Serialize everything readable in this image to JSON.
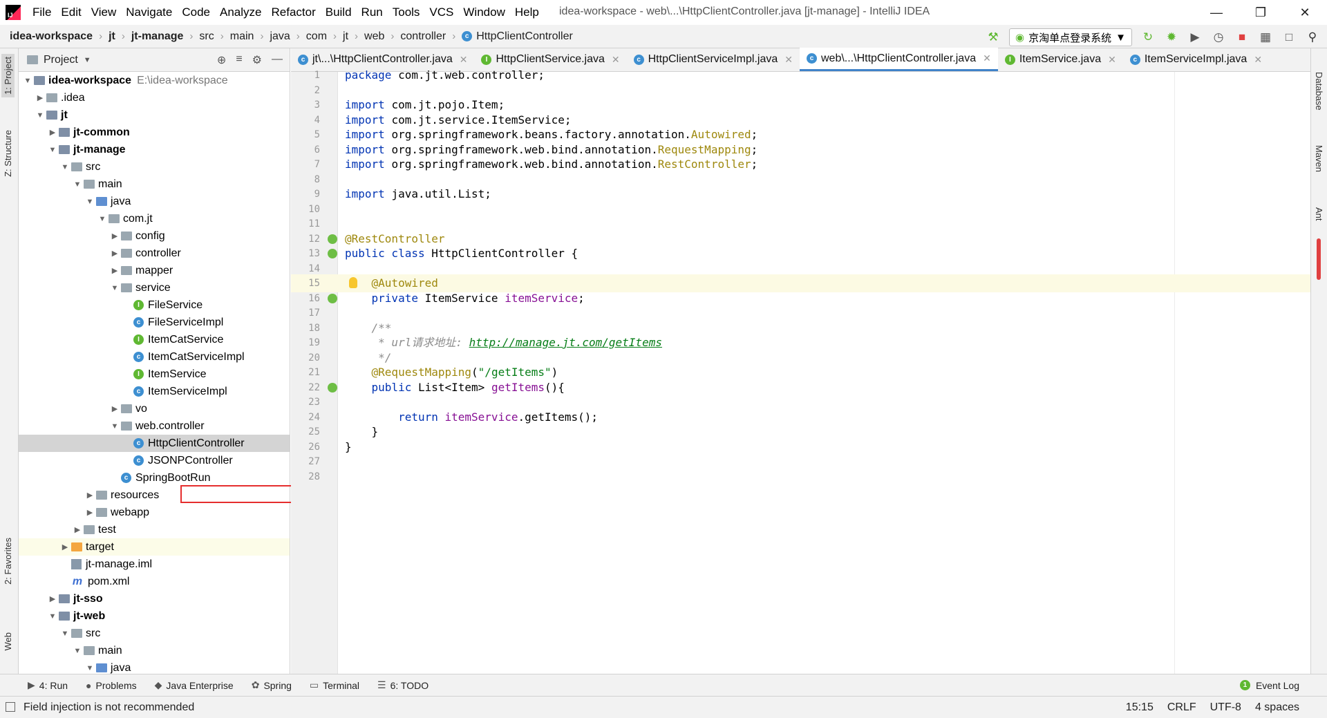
{
  "window": {
    "title": "idea-workspace - web\\...\\HttpClientController.java [jt-manage] - IntelliJ IDEA"
  },
  "menu": [
    "File",
    "Edit",
    "View",
    "Navigate",
    "Code",
    "Analyze",
    "Refactor",
    "Build",
    "Run",
    "Tools",
    "VCS",
    "Window",
    "Help"
  ],
  "breadcrumb": [
    "idea-workspace",
    "jt",
    "jt-manage",
    "src",
    "main",
    "java",
    "com",
    "jt",
    "web",
    "controller",
    "HttpClientController"
  ],
  "run_config": "京淘单点登录系统",
  "side_left": {
    "project": "1: Project",
    "structure": "Z: Structure",
    "favorites": "2: Favorites",
    "web": "Web"
  },
  "side_right": {
    "database": "Database",
    "maven": "Maven",
    "ant": "Ant"
  },
  "project_panel": {
    "title": "Project"
  },
  "tree": [
    {
      "label": "idea-workspace",
      "path": "E:\\idea-workspace",
      "depth": 0,
      "arrow": "▼",
      "icon": "mod",
      "bold": true
    },
    {
      "label": ".idea",
      "depth": 1,
      "arrow": "▶",
      "icon": "folder"
    },
    {
      "label": "jt",
      "depth": 1,
      "arrow": "▼",
      "icon": "mod",
      "bold": true
    },
    {
      "label": "jt-common",
      "depth": 2,
      "arrow": "▶",
      "icon": "mod",
      "bold": true
    },
    {
      "label": "jt-manage",
      "depth": 2,
      "arrow": "▼",
      "icon": "mod",
      "bold": true
    },
    {
      "label": "src",
      "depth": 3,
      "arrow": "▼",
      "icon": "folder"
    },
    {
      "label": "main",
      "depth": 4,
      "arrow": "▼",
      "icon": "folder"
    },
    {
      "label": "java",
      "depth": 5,
      "arrow": "▼",
      "icon": "src"
    },
    {
      "label": "com.jt",
      "depth": 6,
      "arrow": "▼",
      "icon": "folder"
    },
    {
      "label": "config",
      "depth": 7,
      "arrow": "▶",
      "icon": "folder"
    },
    {
      "label": "controller",
      "depth": 7,
      "arrow": "▶",
      "icon": "folder"
    },
    {
      "label": "mapper",
      "depth": 7,
      "arrow": "▶",
      "icon": "folder"
    },
    {
      "label": "service",
      "depth": 7,
      "arrow": "▼",
      "icon": "folder"
    },
    {
      "label": "FileService",
      "depth": 8,
      "arrow": "",
      "icon": "i"
    },
    {
      "label": "FileServiceImpl",
      "depth": 8,
      "arrow": "",
      "icon": "c"
    },
    {
      "label": "ItemCatService",
      "depth": 8,
      "arrow": "",
      "icon": "i"
    },
    {
      "label": "ItemCatServiceImpl",
      "depth": 8,
      "arrow": "",
      "icon": "c"
    },
    {
      "label": "ItemService",
      "depth": 8,
      "arrow": "",
      "icon": "i"
    },
    {
      "label": "ItemServiceImpl",
      "depth": 8,
      "arrow": "",
      "icon": "c"
    },
    {
      "label": "vo",
      "depth": 7,
      "arrow": "▶",
      "icon": "folder"
    },
    {
      "label": "web.controller",
      "depth": 7,
      "arrow": "▼",
      "icon": "folder"
    },
    {
      "label": "HttpClientController",
      "depth": 8,
      "arrow": "",
      "icon": "c",
      "selected": true
    },
    {
      "label": "JSONPController",
      "depth": 8,
      "arrow": "",
      "icon": "c"
    },
    {
      "label": "SpringBootRun",
      "depth": 7,
      "arrow": "",
      "icon": "c"
    },
    {
      "label": "resources",
      "depth": 5,
      "arrow": "▶",
      "icon": "folder"
    },
    {
      "label": "webapp",
      "depth": 5,
      "arrow": "▶",
      "icon": "folder"
    },
    {
      "label": "test",
      "depth": 4,
      "arrow": "▶",
      "icon": "folder"
    },
    {
      "label": "target",
      "depth": 3,
      "arrow": "▶",
      "icon": "orange",
      "highlight": true
    },
    {
      "label": "jt-manage.iml",
      "depth": 3,
      "arrow": "",
      "icon": "iml"
    },
    {
      "label": "pom.xml",
      "depth": 3,
      "arrow": "",
      "icon": "m"
    },
    {
      "label": "jt-sso",
      "depth": 2,
      "arrow": "▶",
      "icon": "mod",
      "bold": true
    },
    {
      "label": "jt-web",
      "depth": 2,
      "arrow": "▼",
      "icon": "mod",
      "bold": true
    },
    {
      "label": "src",
      "depth": 3,
      "arrow": "▼",
      "icon": "folder"
    },
    {
      "label": "main",
      "depth": 4,
      "arrow": "▼",
      "icon": "folder"
    },
    {
      "label": "java",
      "depth": 5,
      "arrow": "▼",
      "icon": "src"
    }
  ],
  "tabs": [
    {
      "label": "jt\\...\\HttpClientController.java",
      "icon": "c"
    },
    {
      "label": "HttpClientService.java",
      "icon": "i"
    },
    {
      "label": "HttpClientServiceImpl.java",
      "icon": "c"
    },
    {
      "label": "web\\...\\HttpClientController.java",
      "icon": "c",
      "active": true
    },
    {
      "label": "ItemService.java",
      "icon": "i"
    },
    {
      "label": "ItemServiceImpl.java",
      "icon": "c"
    }
  ],
  "code": [
    [
      [
        "kw",
        "package "
      ],
      [
        "",
        "com.jt.web.controller;"
      ]
    ],
    [],
    [
      [
        "kw",
        "import "
      ],
      [
        "",
        "com.jt.pojo.Item;"
      ]
    ],
    [
      [
        "kw",
        "import "
      ],
      [
        "",
        "com.jt.service.ItemService;"
      ]
    ],
    [
      [
        "kw",
        "import "
      ],
      [
        "",
        "org.springframework.beans.factory.annotation."
      ],
      [
        "ann",
        "Autowired"
      ],
      [
        "",
        ";"
      ]
    ],
    [
      [
        "kw",
        "import "
      ],
      [
        "",
        "org.springframework.web.bind.annotation."
      ],
      [
        "ann",
        "RequestMapping"
      ],
      [
        "",
        ";"
      ]
    ],
    [
      [
        "kw",
        "import "
      ],
      [
        "",
        "org.springframework.web.bind.annotation."
      ],
      [
        "ann",
        "RestController"
      ],
      [
        "",
        ";"
      ]
    ],
    [],
    [
      [
        "kw",
        "import "
      ],
      [
        "",
        "java.util.List;"
      ]
    ],
    [],
    [],
    [
      [
        "ann",
        "@RestController"
      ]
    ],
    [
      [
        "kw",
        "public class "
      ],
      [
        "",
        "HttpClientController {"
      ]
    ],
    [],
    [
      [
        "",
        "    "
      ],
      [
        "ann",
        "@Autowired"
      ]
    ],
    [
      [
        "",
        "    "
      ],
      [
        "kw",
        "private "
      ],
      [
        "",
        "ItemService "
      ],
      [
        "fld",
        "itemService"
      ],
      [
        "",
        ";"
      ]
    ],
    [],
    [
      [
        "cmt",
        "    /**"
      ]
    ],
    [
      [
        "cmt",
        "     * url请求地址: "
      ],
      [
        "lnk",
        "http://manage.jt.com/getItems"
      ]
    ],
    [
      [
        "cmt",
        "     */"
      ]
    ],
    [
      [
        "",
        "    "
      ],
      [
        "ann",
        "@RequestMapping"
      ],
      [
        "",
        "("
      ],
      [
        "str",
        "\"/getItems\""
      ],
      [
        "",
        ")"
      ]
    ],
    [
      [
        "",
        "    "
      ],
      [
        "kw",
        "public "
      ],
      [
        "",
        "List<Item> "
      ],
      [
        "fld",
        "getItems"
      ],
      [
        "",
        "(){"
      ]
    ],
    [],
    [
      [
        "",
        "        "
      ],
      [
        "kw",
        "return "
      ],
      [
        "fld",
        "itemService"
      ],
      [
        "",
        ".getItems();"
      ]
    ],
    [
      [
        "",
        "    }"
      ]
    ],
    [
      [
        "",
        "}"
      ]
    ],
    [],
    []
  ],
  "bottom_tools": [
    "4: Run",
    "Problems",
    "Java Enterprise",
    "Spring",
    "Terminal",
    "6: TODO"
  ],
  "event_log": "Event Log",
  "status": {
    "message": "Field injection is not recommended",
    "position": "15:15",
    "line_sep": "CRLF",
    "encoding": "UTF-8",
    "indent": "4 spaces"
  }
}
